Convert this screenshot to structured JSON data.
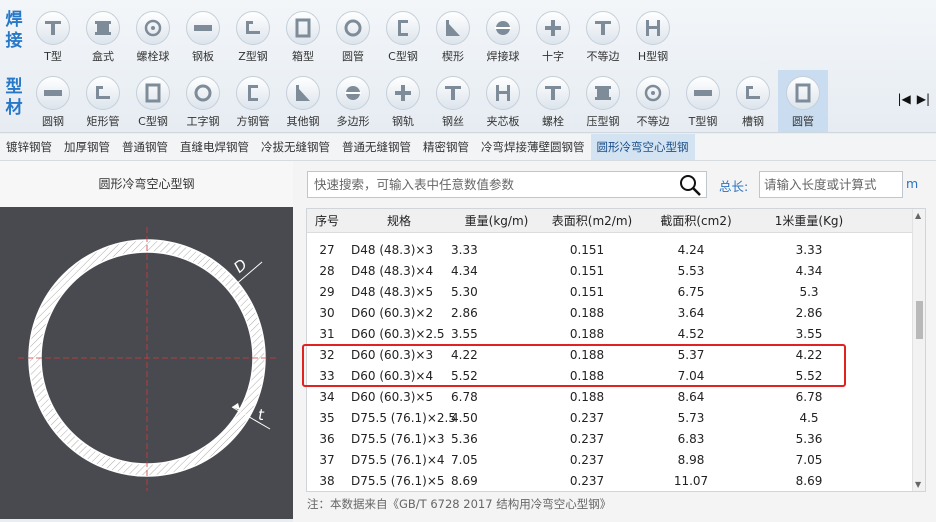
{
  "toolbar": {
    "group1": [
      "焊",
      "接"
    ],
    "group2": [
      "型",
      "材"
    ],
    "row1": [
      {
        "label": "T型",
        "icon": "t-section-icon"
      },
      {
        "label": "盒式",
        "icon": "box-section-icon"
      },
      {
        "label": "螺栓球",
        "icon": "bolt-ball-icon"
      },
      {
        "label": "钢板",
        "icon": "steel-plate-icon"
      },
      {
        "label": "Z型钢",
        "icon": "z-section-icon"
      },
      {
        "label": "箱型",
        "icon": "box-icon"
      },
      {
        "label": "圆管",
        "icon": "round-tube-icon"
      },
      {
        "label": "C型钢",
        "icon": "c-section-icon"
      },
      {
        "label": "楔形",
        "icon": "wedge-icon"
      },
      {
        "label": "焊接球",
        "icon": "welded-ball-icon"
      },
      {
        "label": "十字",
        "icon": "cross-section-icon"
      },
      {
        "label": "不等边",
        "icon": "unequal-icon"
      },
      {
        "label": "H型钢",
        "icon": "h-section-icon"
      }
    ],
    "row2": [
      {
        "label": "圆钢",
        "icon": "round-bar-icon"
      },
      {
        "label": "矩形管",
        "icon": "rect-tube-icon"
      },
      {
        "label": "C型钢",
        "icon": "c-channel-icon"
      },
      {
        "label": "工字钢",
        "icon": "i-beam-icon"
      },
      {
        "label": "方钢管",
        "icon": "square-tube-icon"
      },
      {
        "label": "其他钢",
        "icon": "hexagon-icon"
      },
      {
        "label": "多边形",
        "icon": "polygon-icon"
      },
      {
        "label": "钢轨",
        "icon": "rail-icon"
      },
      {
        "label": "钢丝",
        "icon": "wire-icon"
      },
      {
        "label": "夹芯板",
        "icon": "sandwich-panel-icon"
      },
      {
        "label": "螺栓",
        "icon": "bolt-icon"
      },
      {
        "label": "压型钢",
        "icon": "profiled-steel-icon"
      },
      {
        "label": "不等边",
        "icon": "angle-icon"
      },
      {
        "label": "T型钢",
        "icon": "t-steel-icon"
      },
      {
        "label": "槽钢",
        "icon": "channel-icon"
      },
      {
        "label": "圆管",
        "icon": "pipe-icon"
      }
    ],
    "nav_first": "|◀",
    "nav_last": "▶|"
  },
  "tabs": [
    "镀锌钢管",
    "加厚钢管",
    "普通钢管",
    "直缝电焊钢管",
    "冷拔无缝钢管",
    "普通无缝钢管",
    "精密钢管",
    "冷弯焊接薄壁圆钢管",
    "圆形冷弯空心型钢"
  ],
  "left": {
    "title": "圆形冷弯空心型钢",
    "dim_D": "D",
    "dim_t": "t"
  },
  "search": {
    "placeholder": "快速搜索，可输入表中任意数值参数"
  },
  "length": {
    "label": "总长:",
    "placeholder": "请输入长度或计算式",
    "unit": "m"
  },
  "table": {
    "headers": [
      "序号",
      "规格",
      "重量(kg/m)",
      "表面积(m2/m)",
      "截面积(cm2)",
      "1米重量(Kg)"
    ],
    "rows": [
      [
        "27",
        "D48 (48.3)×3",
        "3.33",
        "0.151",
        "4.24",
        "3.33"
      ],
      [
        "28",
        "D48 (48.3)×4",
        "4.34",
        "0.151",
        "5.53",
        "4.34"
      ],
      [
        "29",
        "D48 (48.3)×5",
        "5.30",
        "0.151",
        "6.75",
        "5.3"
      ],
      [
        "30",
        "D60 (60.3)×2",
        "2.86",
        "0.188",
        "3.64",
        "2.86"
      ],
      [
        "31",
        "D60 (60.3)×2.5",
        "3.55",
        "0.188",
        "4.52",
        "3.55"
      ],
      [
        "32",
        "D60 (60.3)×3",
        "4.22",
        "0.188",
        "5.37",
        "4.22"
      ],
      [
        "33",
        "D60 (60.3)×4",
        "5.52",
        "0.188",
        "7.04",
        "5.52"
      ],
      [
        "34",
        "D60 (60.3)×5",
        "6.78",
        "0.188",
        "8.64",
        "6.78"
      ],
      [
        "35",
        "D75.5 (76.1)×2.5",
        "4.50",
        "0.237",
        "5.73",
        "4.5"
      ],
      [
        "36",
        "D75.5 (76.1)×3",
        "5.36",
        "0.237",
        "6.83",
        "5.36"
      ],
      [
        "37",
        "D75.5 (76.1)×4",
        "7.05",
        "0.237",
        "8.98",
        "7.05"
      ],
      [
        "38",
        "D75.5 (76.1)×5",
        "8.69",
        "0.237",
        "11.07",
        "8.69"
      ]
    ],
    "highlight_color": "#e02222"
  },
  "note": "注：本数据来自《GB/T 6728 2017  结构用冷弯空心型钢》"
}
